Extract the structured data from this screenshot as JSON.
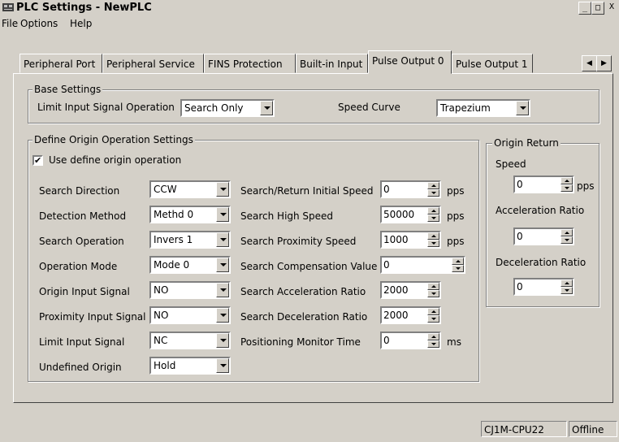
{
  "window": {
    "title": "PLC Settings - NewPLC"
  },
  "menu": [
    "File",
    "Options",
    "Help"
  ],
  "tabs": [
    "Peripheral Port",
    "Peripheral Service",
    "FINS Protection",
    "Built-in Input",
    "Pulse Output 0",
    "Pulse Output 1"
  ],
  "active_tab": "Pulse Output 0",
  "base": {
    "title": "Base Settings",
    "limit_label": "Limit Input Signal Operation",
    "limit_value": "Search Only",
    "curve_label": "Speed Curve",
    "curve_value": "Trapezium"
  },
  "origin_def": {
    "title": "Define Origin Operation Settings",
    "use_label": "Use define origin operation",
    "use_checked": "✔",
    "rows": [
      {
        "label": "Search Direction",
        "value": "CCW"
      },
      {
        "label": "Detection Method",
        "value": "Methd 0"
      },
      {
        "label": "Search Operation",
        "value": "Invers 1"
      },
      {
        "label": "Operation Mode",
        "value": "Mode 0"
      },
      {
        "label": "Origin Input Signal",
        "value": "NO"
      },
      {
        "label": "Proximity Input Signal",
        "value": "NO"
      },
      {
        "label": "Limit Input Signal",
        "value": "NC"
      },
      {
        "label": "Undefined Origin",
        "value": "Hold"
      }
    ],
    "params": [
      {
        "label": "Search/Return Initial Speed",
        "value": "0",
        "unit": "pps"
      },
      {
        "label": "Search High Speed",
        "value": "50000",
        "unit": "pps"
      },
      {
        "label": "Search Proximity Speed",
        "value": "1000",
        "unit": "pps"
      },
      {
        "label": "Search Compensation Value",
        "value": "0",
        "unit": ""
      },
      {
        "label": "Search Acceleration Ratio",
        "value": "2000",
        "unit": ""
      },
      {
        "label": "Search Deceleration Ratio",
        "value": "2000",
        "unit": ""
      },
      {
        "label": "Positioning Monitor Time",
        "value": "0",
        "unit": "ms"
      }
    ]
  },
  "origin_return": {
    "title": "Origin Return",
    "speed_label": "Speed",
    "speed_value": "0",
    "speed_unit": "pps",
    "accel_label": "Acceleration Ratio",
    "accel_value": "0",
    "decel_label": "Deceleration Ratio",
    "decel_value": "0"
  },
  "status": {
    "device": "CJ1M-CPU22",
    "mode": "Offline"
  }
}
